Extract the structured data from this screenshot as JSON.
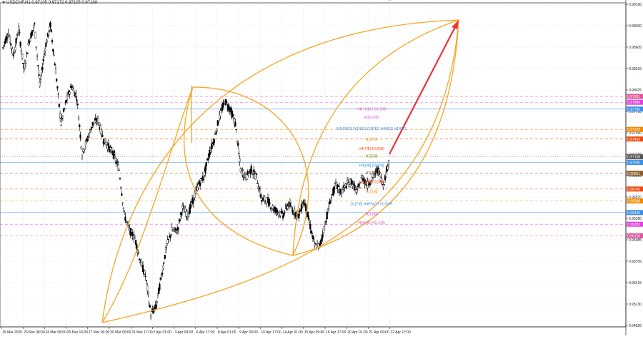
{
  "window": {
    "symbol_header": "USDCHF,H1  0.97105 0.97172 0.97105 0.97168"
  },
  "colors": {
    "background": "#ffffff",
    "candles": "#000000",
    "curves": "#f5a623",
    "arrow": "#e8333a",
    "grid": "#e0e0e0"
  },
  "chart_data": {
    "type": "candlestick",
    "symbol": "USDCHF",
    "timeframe": "H1",
    "ohlc_header": {
      "open": 0.97105,
      "high": 0.97172,
      "low": 0.97105,
      "close": 0.97168
    },
    "ylim": [
      0.94935,
      0.9919
    ],
    "y_ticks": [
      "0.99190",
      "0.98900",
      "0.98605",
      "0.98315",
      "0.98025",
      "0.97730",
      "0.97450",
      "0.97155",
      "0.96860",
      "0.96570",
      "0.96280",
      "0.95985",
      "0.95705",
      "0.95415",
      "0.95130",
      "0.94835"
    ],
    "x_ticks": [
      "19 Mar 2020",
      "23 Mar 08:00",
      "24 Mar 08:00",
      "25 Mar 16:00",
      "27 Mar 00:00",
      "30 Mar 09:00",
      "31 Mar 17:00",
      "2 Apr 01:00",
      "3 Apr 09:00",
      "6 Apr 17:00",
      "8 Apr 01:00",
      "9 Apr 09:00",
      "10 Apr 17:00",
      "14 Apr 01:00",
      "15 Apr 09:00",
      "16 Apr 17:00",
      "20 Apr 01:00",
      "21 Apr 09:00",
      "22 Apr 17:00"
    ],
    "price_path": [
      [
        0.986,
        0.9872
      ],
      [
        0.988,
        0.987
      ],
      [
        0.985,
        0.984
      ],
      [
        0.9885,
        0.9895
      ],
      [
        0.983,
        0.982
      ],
      [
        0.987,
        0.986
      ],
      [
        0.989,
        0.99
      ],
      [
        0.981,
        0.98
      ],
      [
        0.986,
        0.985
      ],
      [
        0.989,
        0.988
      ],
      [
        0.983,
        0.984
      ],
      [
        0.976,
        0.9745
      ],
      [
        0.979,
        0.98
      ],
      [
        0.981,
        0.979
      ],
      [
        0.9795,
        0.9775
      ],
      [
        0.972,
        0.969
      ],
      [
        0.974,
        0.973
      ],
      [
        0.976,
        0.974
      ],
      [
        0.9765,
        0.975
      ],
      [
        0.974,
        0.972
      ],
      [
        0.973,
        0.971
      ],
      [
        0.972,
        0.97
      ],
      [
        0.97,
        0.965
      ],
      [
        0.964,
        0.96
      ],
      [
        0.962,
        0.958
      ],
      [
        0.961,
        0.956
      ],
      [
        0.958,
        0.954
      ],
      [
        0.956,
        0.95
      ],
      [
        0.951,
        0.951
      ],
      [
        0.952,
        0.956
      ],
      [
        0.956,
        0.959
      ],
      [
        0.96,
        0.961
      ],
      [
        0.962,
        0.963
      ],
      [
        0.962,
        0.964
      ],
      [
        0.965,
        0.966
      ],
      [
        0.964,
        0.967
      ],
      [
        0.966,
        0.968
      ],
      [
        0.968,
        0.97
      ],
      [
        0.969,
        0.972
      ],
      [
        0.972,
        0.974
      ],
      [
        0.974,
        0.9765
      ],
      [
        0.977,
        0.9785
      ],
      [
        0.979,
        0.978
      ],
      [
        0.978,
        0.977
      ],
      [
        0.976,
        0.97
      ],
      [
        0.97,
        0.968
      ],
      [
        0.969,
        0.969
      ],
      [
        0.97,
        0.97
      ],
      [
        0.969,
        0.967
      ],
      [
        0.966,
        0.965
      ],
      [
        0.966,
        0.966
      ],
      [
        0.965,
        0.964
      ],
      [
        0.9645,
        0.9635
      ],
      [
        0.964,
        0.965
      ],
      [
        0.9655,
        0.966
      ],
      [
        0.9645,
        0.964
      ],
      [
        0.964,
        0.966
      ],
      [
        0.966,
        0.965
      ],
      [
        0.963,
        0.961
      ],
      [
        0.96,
        0.959
      ],
      [
        0.96,
        0.962
      ],
      [
        0.963,
        0.965
      ],
      [
        0.966,
        0.967
      ],
      [
        0.968,
        0.969
      ],
      [
        0.967,
        0.967
      ],
      [
        0.968,
        0.969
      ],
      [
        0.9685,
        0.967
      ],
      [
        0.967,
        0.969
      ],
      [
        0.969,
        0.97
      ],
      [
        0.968,
        0.967
      ],
      [
        0.969,
        0.97
      ],
      [
        0.97,
        0.969
      ],
      [
        0.968,
        0.97
      ],
      [
        0.971,
        0.9717
      ]
    ],
    "annotations": [
      {
        "text": "H4(+1/8) H1(+2/8)",
        "color": "#e0559b",
        "price": 0.978
      },
      {
        "text": "H1(+1/8)",
        "color": "#e040e0",
        "price": 0.9769
      },
      {
        "text": "MN1RES W1RES D1RES H4RES H1RES",
        "color": "#3a8ee8",
        "price": 0.9754
      },
      {
        "text": "H1[7/8]",
        "color": "#f08a00",
        "price": 0.974
      },
      {
        "text": "H4(7/8) H1(6/8)",
        "color": "#f04a10",
        "price": 0.9728
      },
      {
        "text": "H1[5/8]",
        "color": "#808000",
        "price": 0.9718
      },
      {
        "text": "H4[6/8] D1[4/8]",
        "color": "#3a8ee8",
        "price": 0.9706
      },
      {
        "text": "H1[4/8]",
        "color": "#8b5a2b",
        "price": 0.9696
      },
      {
        "text": "H4[5/8] H1[3/8]",
        "color": "#f04a10",
        "price": 0.9684
      },
      {
        "text": "H1[1/8]",
        "color": "#f08a00",
        "price": 0.9671
      },
      {
        "text": "D1[7/8] H4PIVOT H1SUP",
        "color": "#3a8ee8",
        "price": 0.9655
      },
      {
        "text": "H1(1/8)",
        "color": "#e040e0",
        "price": 0.9642
      },
      {
        "text": "H4(5/8) H1(-1/8)",
        "color": "#e0559b",
        "price": 0.9631
      }
    ],
    "levels": [
      {
        "price": 0.97961,
        "label": "0.97961",
        "color": "#e0559b",
        "style": "dash"
      },
      {
        "price": 0.97885,
        "label": "0.97885",
        "color": "#e040e0",
        "style": "dash"
      },
      {
        "price": 0.97795,
        "label": "0.97795",
        "color": "#3a8ee8",
        "style": "solid"
      },
      {
        "price": 0.97529,
        "label": "0.97529",
        "color": "#f08a00",
        "style": "dash"
      },
      {
        "price": 0.97402,
        "label": "0.97402",
        "color": "#f04a10",
        "style": "dash"
      },
      {
        "price": 0.97168,
        "label": "0.97168",
        "color": "#555555",
        "style": "dot"
      },
      {
        "price": 0.97095,
        "label": "0.97095",
        "color": "#3a8ee8",
        "style": "solid"
      },
      {
        "price": 0.96951,
        "label": "0.96951",
        "color": "#8b5a2b",
        "style": "dash"
      },
      {
        "price": 0.96745,
        "label": "0.96745",
        "color": "#f04a10",
        "style": "dash"
      },
      {
        "price": 0.96588,
        "label": "0.96588",
        "color": "#f08a00",
        "style": "dash"
      },
      {
        "price": 0.96436,
        "label": "0.96436",
        "color": "#3a8ee8",
        "style": "solid"
      },
      {
        "price": 0.96283,
        "label": "0.96283",
        "color": "#e040e0",
        "style": "dash"
      },
      {
        "price": 0.9613,
        "label": "0.96130",
        "color": "#e0559b",
        "style": "dash"
      }
    ]
  }
}
